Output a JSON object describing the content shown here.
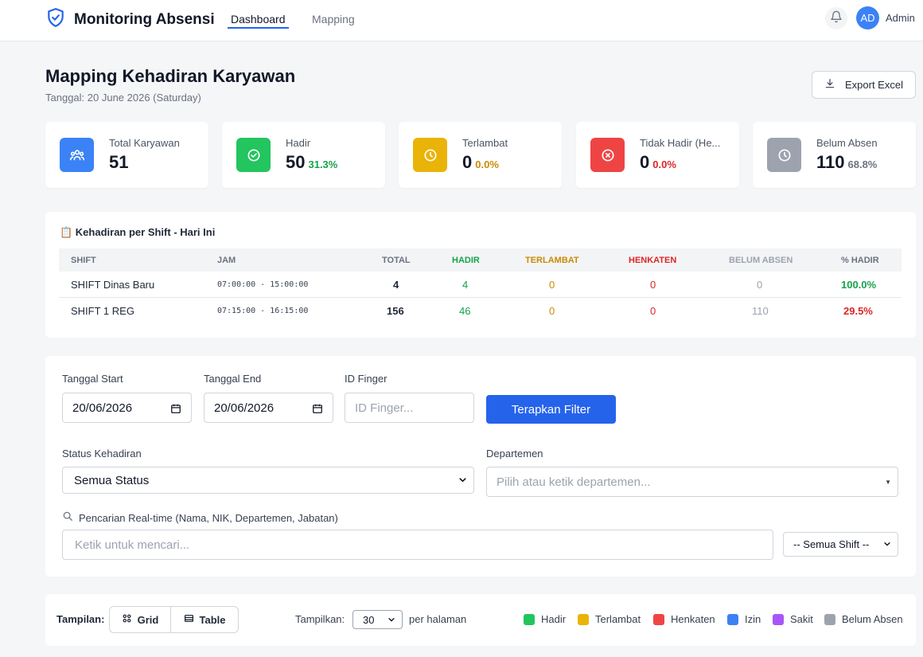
{
  "nav": {
    "brand": "Monitoring Absensi",
    "links": [
      "Dashboard",
      "Mapping"
    ],
    "user_initials": "AD",
    "user_name": "Admin"
  },
  "header": {
    "title": "Mapping Kehadiran Karyawan",
    "date": "Tanggal: 20 June 2026 (Saturday)",
    "export_label": "Export Excel"
  },
  "stats": [
    {
      "label": "Total Karyawan",
      "value": "51",
      "pct": "",
      "color": "#3b82f6",
      "icon": "users-icon"
    },
    {
      "label": "Hadir",
      "value": "50",
      "pct": "31.3%",
      "color": "#22c55e",
      "pct_color": "#16a34a",
      "icon": "check-circle-icon"
    },
    {
      "label": "Terlambat",
      "value": "0",
      "pct": "0.0%",
      "color": "#eab308",
      "pct_color": "#ca8a04",
      "icon": "clock-icon"
    },
    {
      "label": "Tidak Hadir (He...",
      "value": "0",
      "pct": "0.0%",
      "color": "#ef4444",
      "pct_color": "#dc2626",
      "icon": "x-circle-icon"
    },
    {
      "label": "Belum Absen",
      "value": "110",
      "pct": "68.8%",
      "color": "#9ca3af",
      "pct_color": "#6b7280",
      "icon": "clock-icon"
    }
  ],
  "shift_table": {
    "title": "📋 Kehadiran per Shift - Hari Ini",
    "headers": [
      "SHIFT",
      "JAM",
      "TOTAL",
      "HADIR",
      "TERLAMBAT",
      "HENKATEN",
      "BELUM ABSEN",
      "% HADIR"
    ],
    "rows": [
      {
        "shift": "SHIFT Dinas Baru",
        "jam": "07:00:00 - 15:00:00",
        "total": "4",
        "hadir": "4",
        "terlambat": "0",
        "henkaten": "0",
        "belum": "0",
        "pct": "100.0%"
      },
      {
        "shift": "SHIFT 1 REG",
        "jam": "07:15:00 - 16:15:00",
        "total": "156",
        "hadir": "46",
        "terlambat": "0",
        "henkaten": "0",
        "belum": "110",
        "pct": "29.5%"
      }
    ]
  },
  "filter": {
    "start_label": "Tanggal Start",
    "start_value": "20/06/2026",
    "end_label": "Tanggal End",
    "end_value": "20/06/2026",
    "finger_label": "ID Finger",
    "finger_placeholder": "ID Finger...",
    "apply_label": "Terapkan Filter",
    "status_label": "Status Kehadiran",
    "status_value": "Semua Status",
    "dept_label": "Departemen",
    "dept_placeholder": "Pilih atau ketik departemen...",
    "search_label": "Pencarian Real-time (Nama, NIK, Departemen, Jabatan)",
    "search_placeholder": "Ketik untuk mencari...",
    "shift_value": "-- Semua Shift --"
  },
  "view": {
    "tampilan_label": "Tampilan:",
    "grid_label": "Grid",
    "table_label": "Table",
    "show_label": "Tampilkan:",
    "per_page": "30",
    "per_page_suffix": "per halaman"
  },
  "legend": [
    {
      "label": "Hadir",
      "color": "#22c55e"
    },
    {
      "label": "Terlambat",
      "color": "#eab308"
    },
    {
      "label": "Henkaten",
      "color": "#ef4444"
    },
    {
      "label": "Izin",
      "color": "#3b82f6"
    },
    {
      "label": "Sakit",
      "color": "#a855f7"
    },
    {
      "label": "Belum Absen",
      "color": "#9ca3af"
    }
  ]
}
